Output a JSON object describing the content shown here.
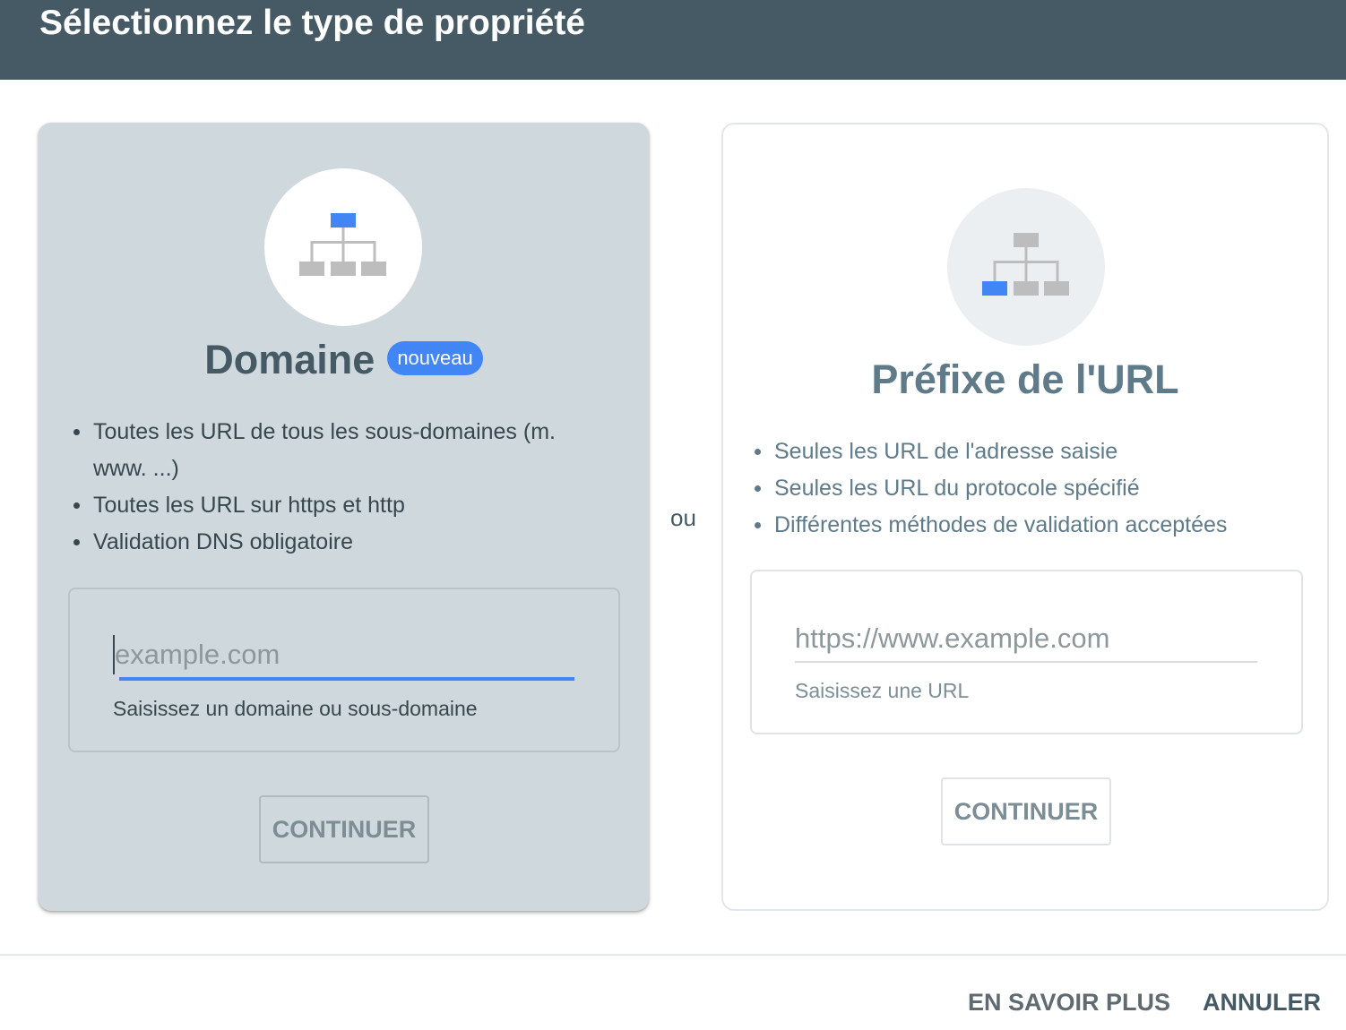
{
  "header": {
    "title": "Sélectionnez le type de propriété"
  },
  "domain_card": {
    "icon": "sitemap-icon",
    "title": "Domaine",
    "badge": "nouveau",
    "bullets": [
      "Toutes les URL de tous les sous-domaines (m. www. ...)",
      "Toutes les URL sur https et http",
      "Validation DNS obligatoire"
    ],
    "input_value": "",
    "input_placeholder": "example.com",
    "helper_text": "Saisissez un domaine ou sous-domaine",
    "continue_label": "CONTINUER"
  },
  "separator": {
    "label": "ou"
  },
  "prefix_card": {
    "icon": "sitemap-icon",
    "title": "Préfixe de l'URL",
    "bullets": [
      "Seules les URL de l'adresse saisie",
      "Seules les URL du protocole spécifié",
      "Différentes méthodes de validation acceptées"
    ],
    "input_value": "",
    "input_placeholder": "https://www.example.com",
    "helper_text": "Saisissez une URL",
    "continue_label": "CONTINUER"
  },
  "footer": {
    "learn_more_label": "EN SAVOIR PLUS",
    "cancel_label": "ANNULER"
  },
  "colors": {
    "header_bg": "#455a64",
    "accent": "#4285f4",
    "domain_card_bg": "#cfd8dc",
    "icon_gray": "#bdbdbd"
  }
}
